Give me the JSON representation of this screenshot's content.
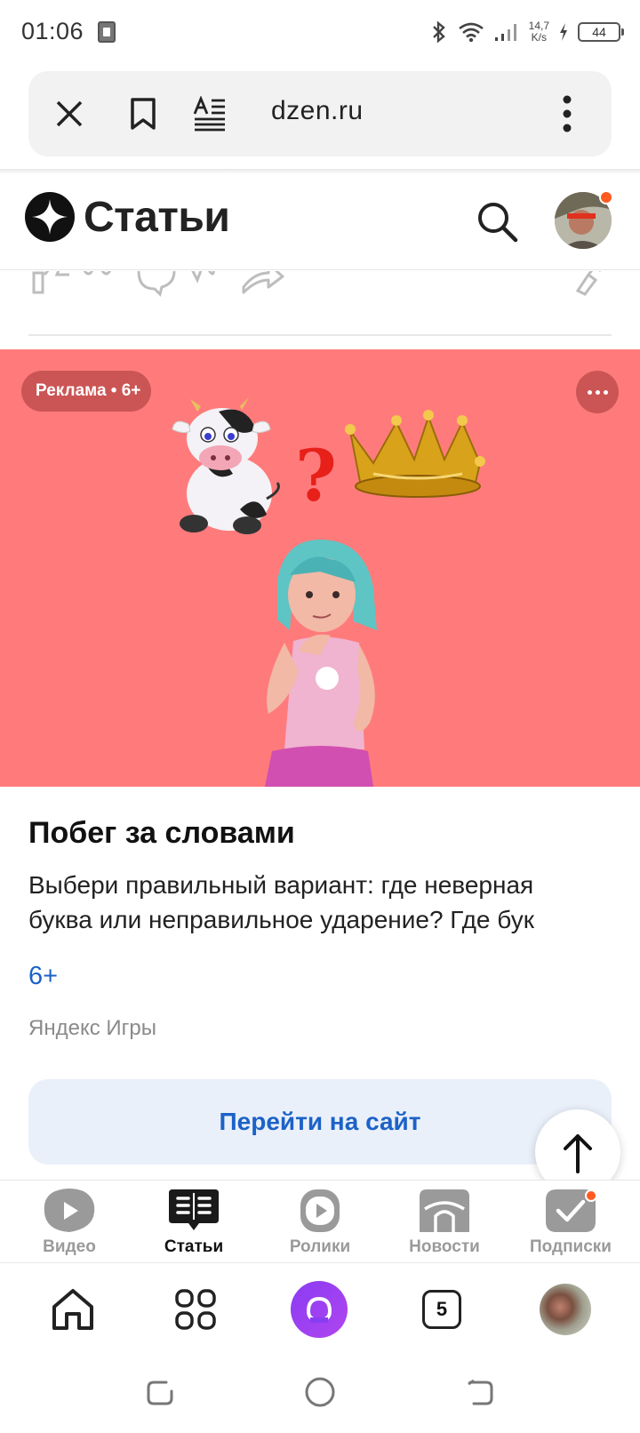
{
  "status_bar": {
    "time": "01:06",
    "net_speed_value": "14,7",
    "net_speed_unit": "K/s",
    "battery": "44"
  },
  "browser": {
    "url": "dzen.ru",
    "close_icon": "close-icon",
    "bookmark_icon": "bookmark-icon",
    "reader_icon": "reader-mode-icon",
    "menu_icon": "more-vertical-icon"
  },
  "dzen_header": {
    "title": "Статьи"
  },
  "ad": {
    "badge": "Реклама • 6+",
    "title": "Побег за словами",
    "description": "Выбери правильный вариант: где неверная\nбуква или неправильное ударение? Где бук",
    "age": "6+",
    "source": "Яндекс Игры",
    "cta": "Перейти на сайт"
  },
  "dzen_nav": {
    "items": [
      {
        "label": "Видео",
        "icon": "video-icon"
      },
      {
        "label": "Статьи",
        "icon": "articles-icon",
        "active": true
      },
      {
        "label": "Ролики",
        "icon": "shorts-icon"
      },
      {
        "label": "Новости",
        "icon": "news-icon"
      },
      {
        "label": "Подписки",
        "icon": "subscriptions-icon"
      }
    ]
  },
  "browser_nav": {
    "tab_count": "5"
  }
}
